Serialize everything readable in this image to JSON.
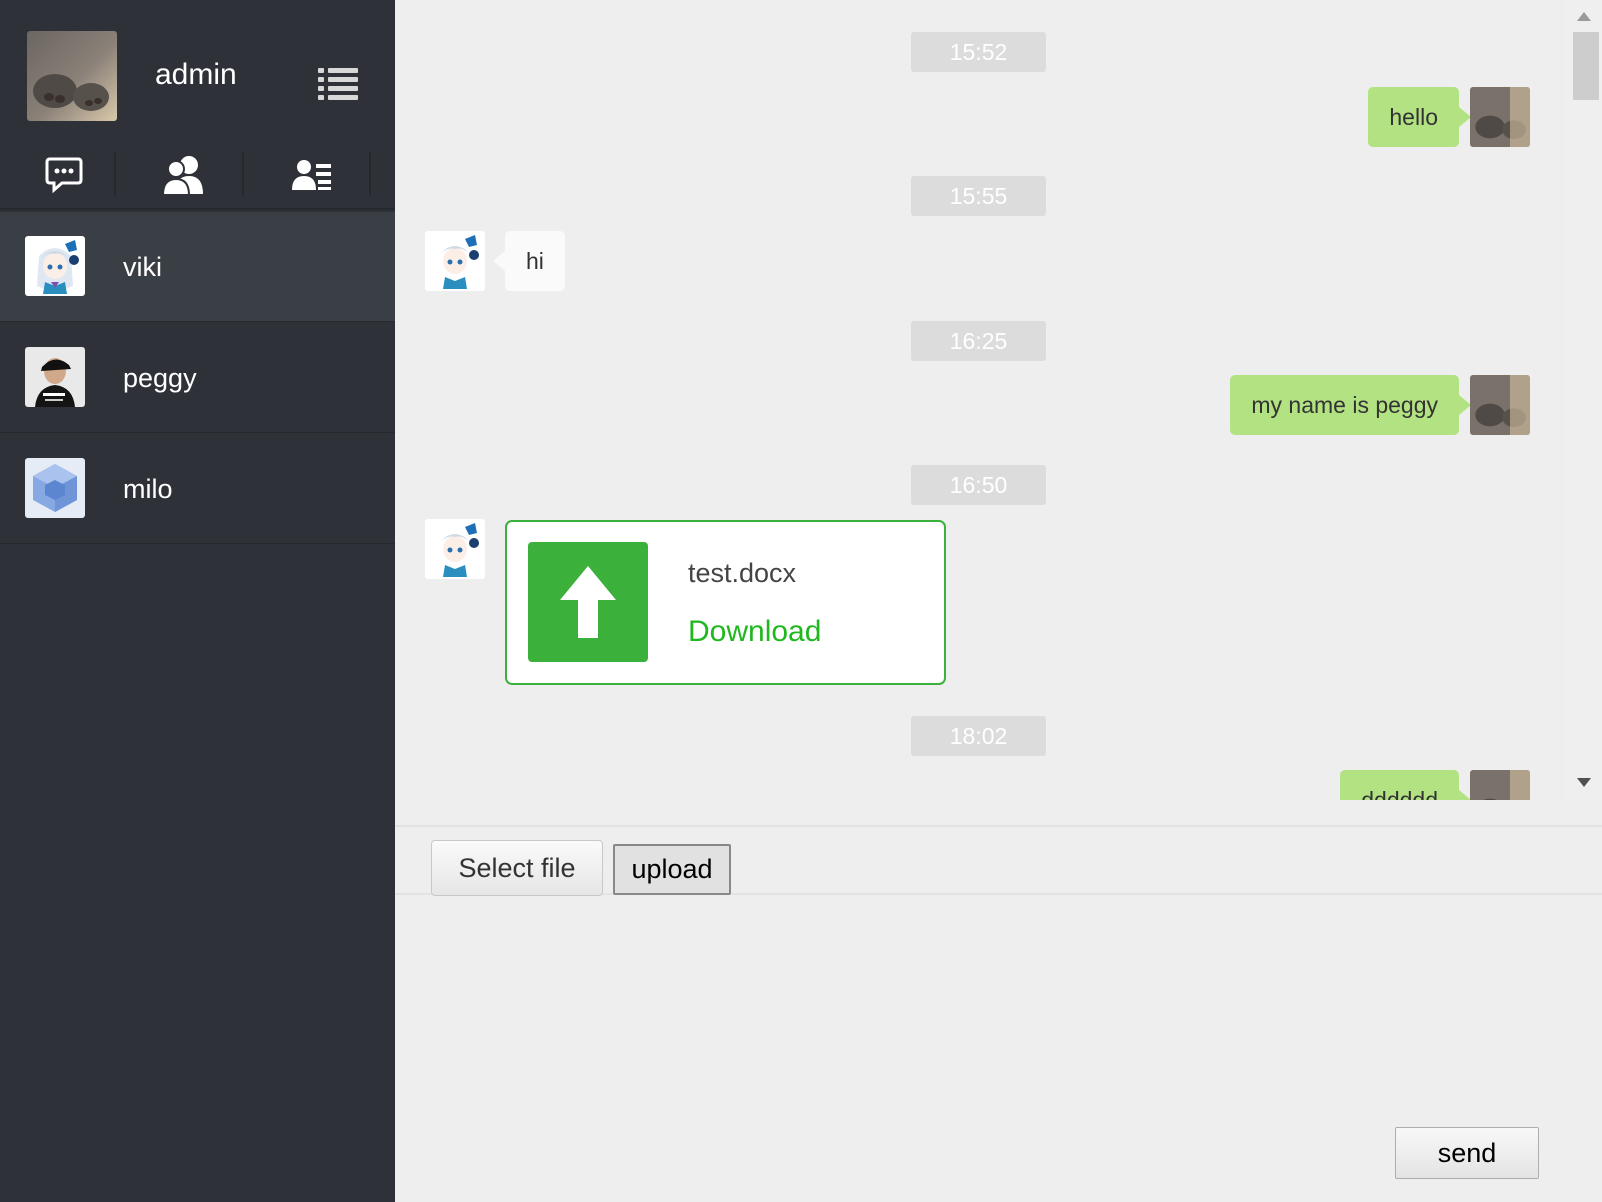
{
  "sidebar": {
    "user": {
      "name": "admin",
      "avatar": "cat-paw-photo"
    },
    "menu_icon": "list-menu-icon",
    "nav": [
      {
        "icon": "chat-bubble-icon"
      },
      {
        "icon": "group-icon"
      },
      {
        "icon": "contact-list-icon"
      }
    ],
    "contacts": [
      {
        "name": "viki",
        "avatar": "anime-girl-avatar",
        "active": true
      },
      {
        "name": "peggy",
        "avatar": "man-cap-photo",
        "active": false
      },
      {
        "name": "milo",
        "avatar": "blue-cube-avatar",
        "active": false
      }
    ]
  },
  "chat": {
    "messages": [
      {
        "time": "15:52"
      },
      {
        "from": "me",
        "text": "hello"
      },
      {
        "time": "15:55"
      },
      {
        "from": "them",
        "text": "hi"
      },
      {
        "time": "16:25"
      },
      {
        "from": "me",
        "text": "my name is peggy"
      },
      {
        "time": "16:50"
      },
      {
        "from": "them",
        "file": {
          "name": "test.docx",
          "action": "Download"
        }
      },
      {
        "time": "18:02"
      },
      {
        "from": "me",
        "text": "dddddd"
      }
    ],
    "toolbar": {
      "select_file": "Select file",
      "upload": "upload"
    },
    "input": {
      "value": "",
      "placeholder": ""
    },
    "send": "send"
  },
  "colors": {
    "sidebar_bg": "#2e3238",
    "active_contact_bg": "#3a3f45",
    "my_bubble": "#b2e281",
    "their_bubble": "#fafafa",
    "file_accent": "#3bb03b",
    "download_link": "#1fb81f",
    "chat_bg": "#eeeeee"
  }
}
